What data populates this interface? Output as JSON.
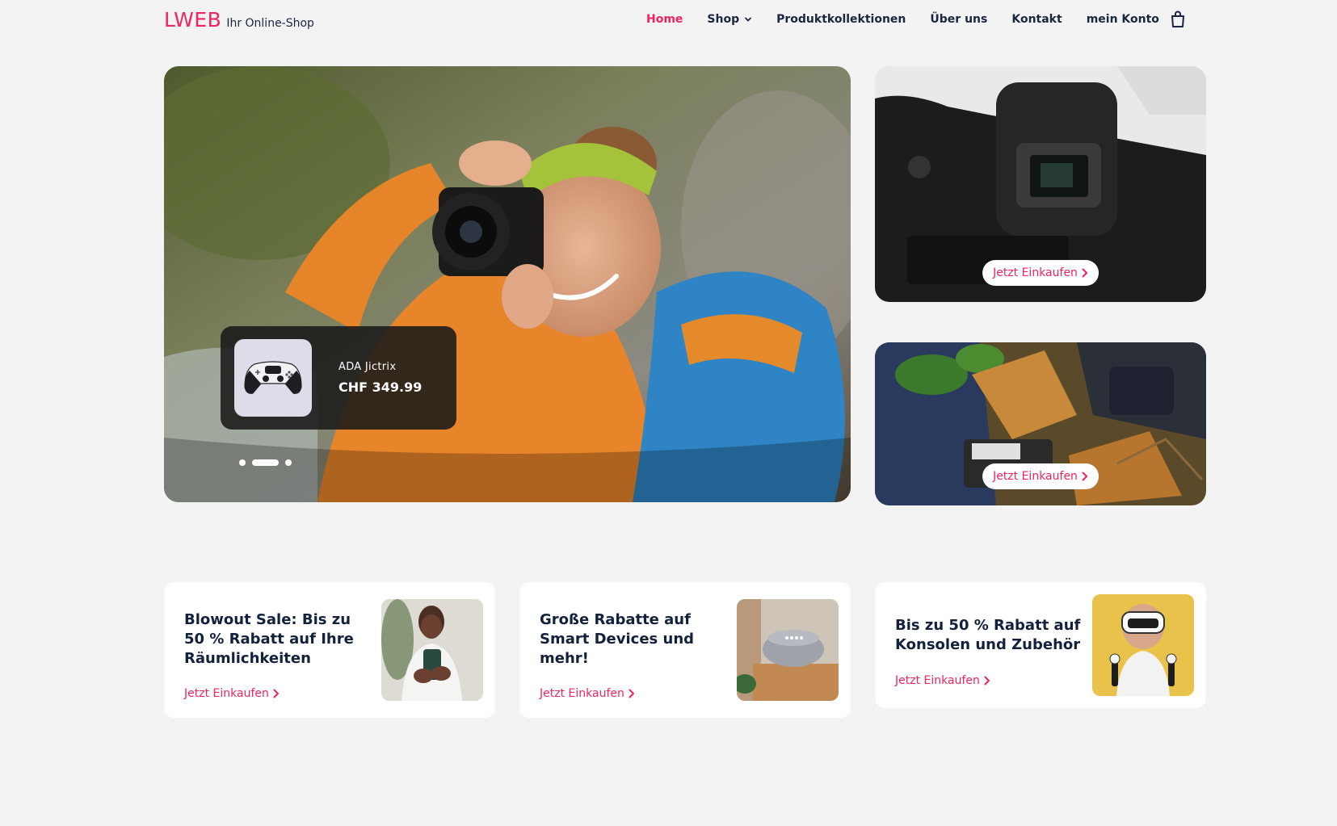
{
  "header": {
    "logo": "LWEB",
    "tagline": "Ihr Online-Shop",
    "nav": [
      "Home",
      "Shop",
      "Produktkollektionen",
      "Über uns",
      "Kontakt",
      "mein Konto"
    ],
    "active_nav": "Home"
  },
  "hero": {
    "product_name": "ADA Jictrix",
    "product_price": "CHF 349.99",
    "slides": 3,
    "active_slide": 2
  },
  "side_banners": [
    {
      "cta": "Jetzt Einkaufen"
    },
    {
      "cta": "Jetzt Einkaufen"
    }
  ],
  "promos": [
    {
      "title": "Blowout Sale: Bis zu 50 % Rabatt auf Ihre Räumlichkeiten",
      "cta": "Jetzt Einkaufen"
    },
    {
      "title": "Große Rabatte auf Smart Devices und mehr!",
      "cta": "Jetzt Einkaufen"
    },
    {
      "title": "Bis zu 50 % Rabatt auf Konsolen und Zubehör",
      "cta": "Jetzt Einkaufen"
    }
  ],
  "colors": {
    "accent": "#f0245f",
    "text": "#14213d",
    "background": "#f3f3f3"
  }
}
